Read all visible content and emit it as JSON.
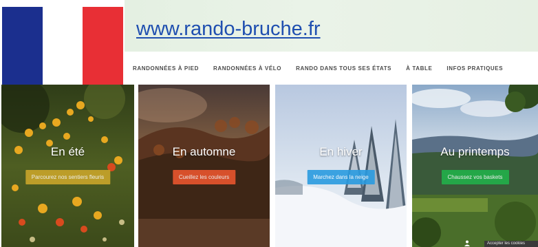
{
  "flag": {
    "colors": [
      "#1b2f8e",
      "#ffffff",
      "#e82f35"
    ]
  },
  "header": {
    "site_url": "www.rando-bruche.fr",
    "link_color": "#1f4fb0"
  },
  "nav": {
    "items": [
      {
        "label": "RANDONNÉES À PIED"
      },
      {
        "label": "RANDONNÉES À VÉLO"
      },
      {
        "label": "RANDO DANS TOUS SES ÉTATS"
      },
      {
        "label": "À TABLE"
      },
      {
        "label": "INFOS PRATIQUES"
      }
    ]
  },
  "cards": [
    {
      "title": "En été",
      "button": "Parcourez nos sentiers fleuris",
      "button_color": "#c9a52a"
    },
    {
      "title": "En automne",
      "button": "Cueillez les couleurs",
      "button_color": "#e8552e"
    },
    {
      "title": "En hiver",
      "button": "Marchez dans la neige",
      "button_color": "#2a9be0"
    },
    {
      "title": "Au printemps",
      "button": "Chaussez vos baskets",
      "button_color": "#22b04a"
    }
  ],
  "badge": {
    "label": "Accepter les cookies"
  }
}
